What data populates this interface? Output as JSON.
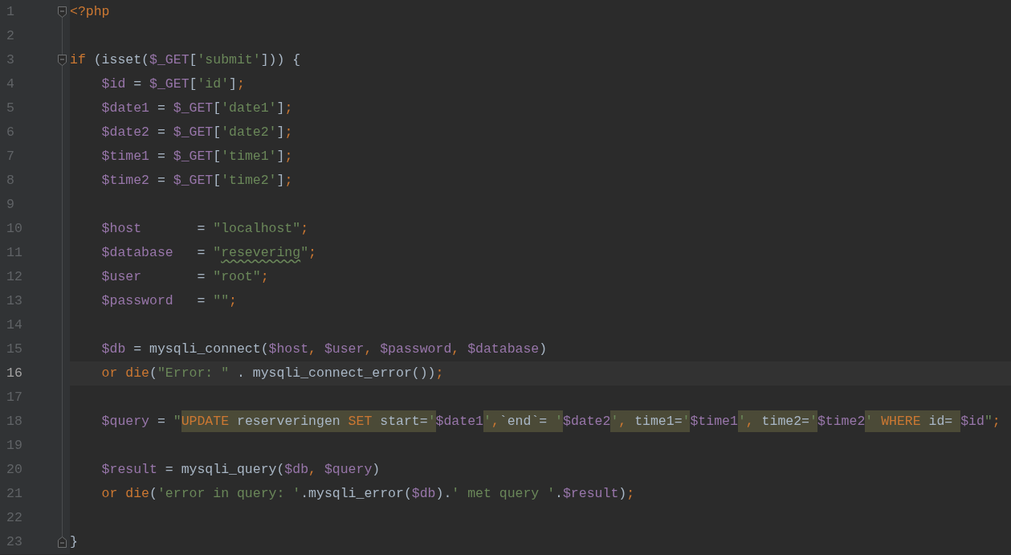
{
  "editor": {
    "lines": [
      {
        "number": "1",
        "current": false,
        "kind": "opener",
        "tokens": [
          {
            "text": "<?php",
            "kind": "keyword"
          }
        ]
      },
      {
        "number": "2",
        "current": false
      },
      {
        "number": "3",
        "current": false,
        "kind": "opener",
        "tokens": [
          {
            "text": "if",
            "kind": "keyword"
          },
          {
            "text": " (isset(",
            "kind": "text"
          },
          {
            "text": "$_GET",
            "kind": "variable"
          },
          {
            "text": "[",
            "kind": "text"
          },
          {
            "text": "'submit'",
            "kind": "string"
          },
          {
            "text": "])) {",
            "kind": "text"
          }
        ]
      },
      {
        "number": "4",
        "current": false,
        "tokens": [
          {
            "text": "    $id",
            "kind": "variable"
          },
          {
            "text": " = ",
            "kind": "text"
          },
          {
            "text": "$_GET",
            "kind": "variable"
          },
          {
            "text": "[",
            "kind": "text"
          },
          {
            "text": "'id'",
            "kind": "string"
          },
          {
            "text": "]",
            "kind": "text"
          },
          {
            "text": ";",
            "kind": "punct"
          }
        ]
      },
      {
        "number": "5",
        "current": false,
        "tokens": [
          {
            "text": "    $date1",
            "kind": "variable"
          },
          {
            "text": " = ",
            "kind": "text"
          },
          {
            "text": "$_GET",
            "kind": "variable"
          },
          {
            "text": "[",
            "kind": "text"
          },
          {
            "text": "'date1'",
            "kind": "string"
          },
          {
            "text": "]",
            "kind": "text"
          },
          {
            "text": ";",
            "kind": "punct"
          }
        ]
      },
      {
        "number": "6",
        "current": false,
        "tokens": [
          {
            "text": "    $date2",
            "kind": "variable"
          },
          {
            "text": " = ",
            "kind": "text"
          },
          {
            "text": "$_GET",
            "kind": "variable"
          },
          {
            "text": "[",
            "kind": "text"
          },
          {
            "text": "'date2'",
            "kind": "string"
          },
          {
            "text": "]",
            "kind": "text"
          },
          {
            "text": ";",
            "kind": "punct"
          }
        ]
      },
      {
        "number": "7",
        "current": false,
        "tokens": [
          {
            "text": "    $time1",
            "kind": "variable"
          },
          {
            "text": " = ",
            "kind": "text"
          },
          {
            "text": "$_GET",
            "kind": "variable"
          },
          {
            "text": "[",
            "kind": "text"
          },
          {
            "text": "'time1'",
            "kind": "string"
          },
          {
            "text": "]",
            "kind": "text"
          },
          {
            "text": ";",
            "kind": "punct"
          }
        ]
      },
      {
        "number": "8",
        "current": false,
        "tokens": [
          {
            "text": "    $time2",
            "kind": "variable"
          },
          {
            "text": " = ",
            "kind": "text"
          },
          {
            "text": "$_GET",
            "kind": "variable"
          },
          {
            "text": "[",
            "kind": "text"
          },
          {
            "text": "'time2'",
            "kind": "string"
          },
          {
            "text": "]",
            "kind": "text"
          },
          {
            "text": ";",
            "kind": "punct"
          }
        ]
      },
      {
        "number": "9",
        "current": false
      },
      {
        "number": "10",
        "current": false,
        "tokens": [
          {
            "text": "    $host",
            "kind": "variable"
          },
          {
            "text": "       = ",
            "kind": "text"
          },
          {
            "text": "\"localhost\"",
            "kind": "string"
          },
          {
            "text": ";",
            "kind": "punct"
          }
        ]
      },
      {
        "number": "11",
        "current": false,
        "tokens": [
          {
            "text": "    $database",
            "kind": "variable"
          },
          {
            "text": "   = ",
            "kind": "text"
          },
          {
            "text": "\"",
            "kind": "string"
          },
          {
            "text": "resevering",
            "kind": "misspelled"
          },
          {
            "text": "\"",
            "kind": "string"
          },
          {
            "text": ";",
            "kind": "punct"
          }
        ]
      },
      {
        "number": "12",
        "current": false,
        "tokens": [
          {
            "text": "    $user",
            "kind": "variable"
          },
          {
            "text": "       = ",
            "kind": "text"
          },
          {
            "text": "\"root\"",
            "kind": "string"
          },
          {
            "text": ";",
            "kind": "punct"
          }
        ]
      },
      {
        "number": "13",
        "current": false,
        "tokens": [
          {
            "text": "    $password",
            "kind": "variable"
          },
          {
            "text": "   = ",
            "kind": "text"
          },
          {
            "text": "\"\"",
            "kind": "string"
          },
          {
            "text": ";",
            "kind": "punct"
          }
        ]
      },
      {
        "number": "14",
        "current": false
      },
      {
        "number": "15",
        "current": false,
        "tokens": [
          {
            "text": "    $db",
            "kind": "variable"
          },
          {
            "text": " = mysqli_connect(",
            "kind": "text"
          },
          {
            "text": "$host",
            "kind": "variable"
          },
          {
            "text": ", ",
            "kind": "punct"
          },
          {
            "text": "$user",
            "kind": "variable"
          },
          {
            "text": ", ",
            "kind": "punct"
          },
          {
            "text": "$password",
            "kind": "variable"
          },
          {
            "text": ", ",
            "kind": "punct"
          },
          {
            "text": "$database",
            "kind": "variable"
          },
          {
            "text": ")",
            "kind": "text"
          }
        ]
      },
      {
        "number": "16",
        "current": true,
        "tokens": [
          {
            "text": "    or die",
            "kind": "keyword"
          },
          {
            "text": "(",
            "kind": "text"
          },
          {
            "text": "\"Error: \"",
            "kind": "string"
          },
          {
            "text": " . mysqli_connect_error())",
            "kind": "text"
          },
          {
            "text": ";",
            "kind": "punct"
          }
        ]
      },
      {
        "number": "17",
        "current": false
      },
      {
        "number": "18",
        "current": false,
        "tokens": [
          {
            "text": "    $query",
            "kind": "variable"
          },
          {
            "text": " = ",
            "kind": "text"
          },
          {
            "text": "\"",
            "kind": "string"
          },
          {
            "text": "UPDATE",
            "kind": "sql-keyword"
          },
          {
            "text": " reserveringen ",
            "kind": "sql-text"
          },
          {
            "text": "SET",
            "kind": "sql-keyword"
          },
          {
            "text": " start=",
            "kind": "sql-text"
          },
          {
            "text": "'",
            "kind": "sql-quote"
          },
          {
            "text": "$date1",
            "kind": "variable"
          },
          {
            "text": "'",
            "kind": "sql-quote"
          },
          {
            "text": ",",
            "kind": "sql-punct"
          },
          {
            "text": "`end`= ",
            "kind": "sql-text"
          },
          {
            "text": "'",
            "kind": "sql-quote"
          },
          {
            "text": "$date2",
            "kind": "variable"
          },
          {
            "text": "'",
            "kind": "sql-quote"
          },
          {
            "text": ",",
            "kind": "sql-punct"
          },
          {
            "text": " time1=",
            "kind": "sql-text"
          },
          {
            "text": "'",
            "kind": "sql-quote"
          },
          {
            "text": "$time1",
            "kind": "variable"
          },
          {
            "text": "'",
            "kind": "sql-quote"
          },
          {
            "text": ",",
            "kind": "sql-punct"
          },
          {
            "text": " time2=",
            "kind": "sql-text"
          },
          {
            "text": "'",
            "kind": "sql-quote"
          },
          {
            "text": "$time2",
            "kind": "variable"
          },
          {
            "text": "'",
            "kind": "sql-quote"
          },
          {
            "text": " WHERE",
            "kind": "sql-keyword"
          },
          {
            "text": " id= ",
            "kind": "sql-text"
          },
          {
            "text": "$id",
            "kind": "variable"
          },
          {
            "text": "\"",
            "kind": "string"
          },
          {
            "text": ";",
            "kind": "punct"
          }
        ]
      },
      {
        "number": "19",
        "current": false
      },
      {
        "number": "20",
        "current": false,
        "tokens": [
          {
            "text": "    $result",
            "kind": "variable"
          },
          {
            "text": " = mysqli_query(",
            "kind": "text"
          },
          {
            "text": "$db",
            "kind": "variable"
          },
          {
            "text": ", ",
            "kind": "punct"
          },
          {
            "text": "$query",
            "kind": "variable"
          },
          {
            "text": ")",
            "kind": "text"
          }
        ]
      },
      {
        "number": "21",
        "current": false,
        "tokens": [
          {
            "text": "    or die",
            "kind": "keyword"
          },
          {
            "text": "(",
            "kind": "text"
          },
          {
            "text": "'error in query: '",
            "kind": "string"
          },
          {
            "text": ".mysqli_error(",
            "kind": "text"
          },
          {
            "text": "$db",
            "kind": "variable"
          },
          {
            "text": ").",
            "kind": "text"
          },
          {
            "text": "' met query '",
            "kind": "string"
          },
          {
            "text": ".",
            "kind": "text"
          },
          {
            "text": "$result",
            "kind": "variable"
          },
          {
            "text": ")",
            "kind": "text"
          },
          {
            "text": ";",
            "kind": "punct"
          }
        ]
      },
      {
        "number": "22",
        "current": false
      },
      {
        "number": "23",
        "current": false,
        "kind": "closer",
        "tokens": [
          {
            "text": "}",
            "kind": "text"
          }
        ]
      }
    ]
  }
}
